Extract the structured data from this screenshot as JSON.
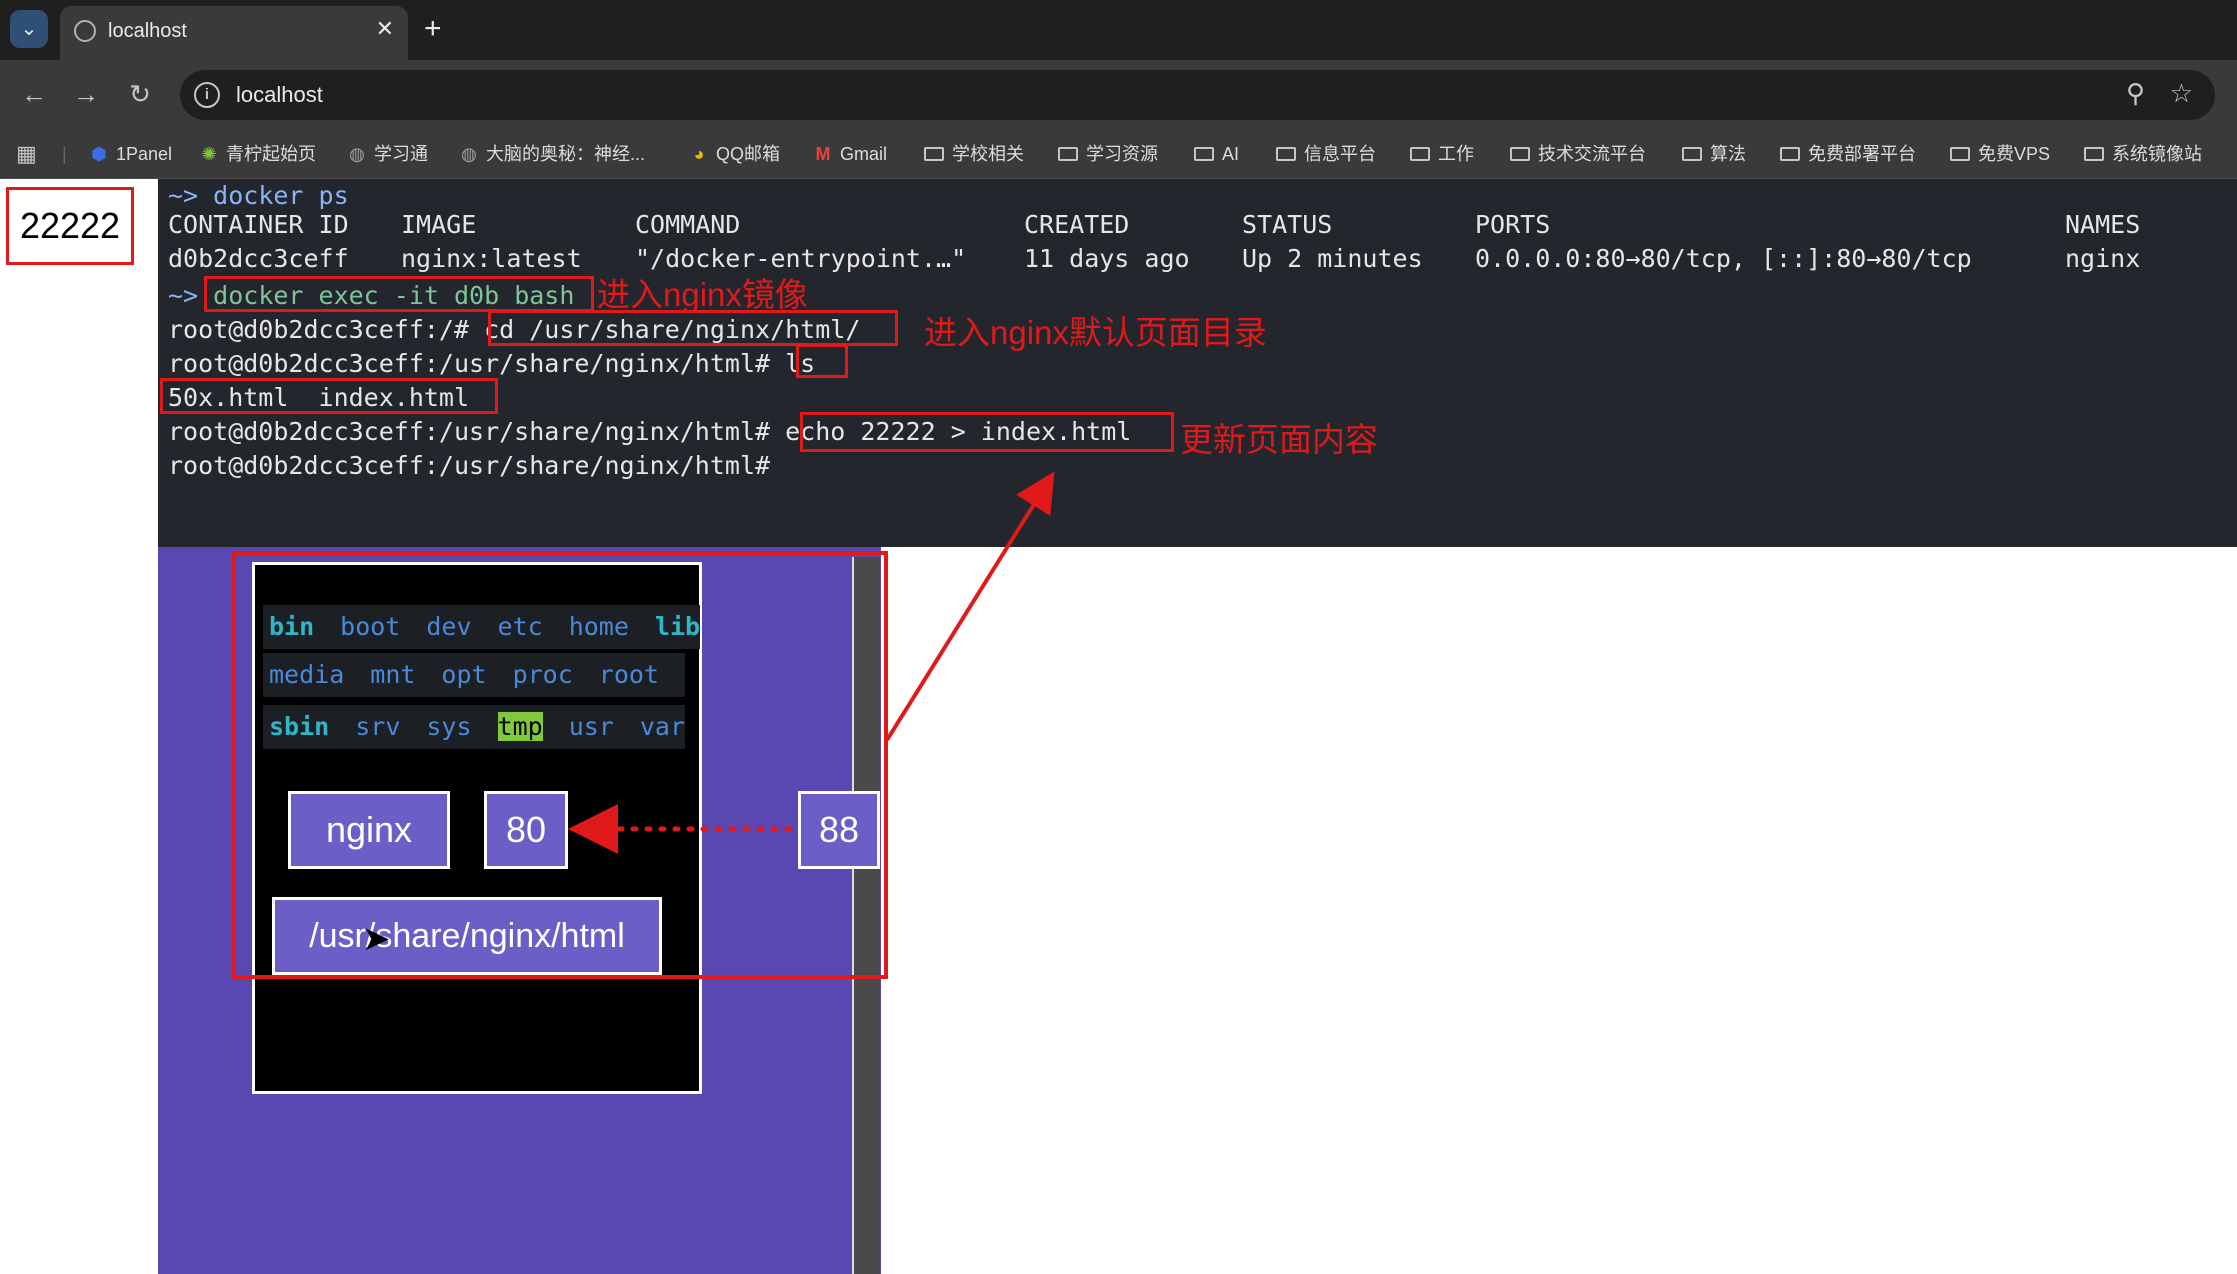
{
  "browser": {
    "tab_title": "localhost",
    "url": "localhost",
    "bookmarks": [
      {
        "label": "1Panel",
        "icon": "shield-icon"
      },
      {
        "label": "青柠起始页",
        "icon": "lime-icon"
      },
      {
        "label": "学习通",
        "icon": "globe-icon"
      },
      {
        "label": "大脑的奥秘：神经...",
        "icon": "globe-icon"
      },
      {
        "label": "QQ邮箱",
        "icon": "chrome-icon"
      },
      {
        "label": "Gmail",
        "icon": "gmail-icon"
      },
      {
        "label": "学校相关",
        "icon": "folder-icon"
      },
      {
        "label": "学习资源",
        "icon": "folder-icon"
      },
      {
        "label": "AI",
        "icon": "folder-icon"
      },
      {
        "label": "信息平台",
        "icon": "folder-icon"
      },
      {
        "label": "工作",
        "icon": "folder-icon"
      },
      {
        "label": "技术交流平台",
        "icon": "folder-icon"
      },
      {
        "label": "算法",
        "icon": "folder-icon"
      },
      {
        "label": "免费部署平台",
        "icon": "folder-icon"
      },
      {
        "label": "免费VPS",
        "icon": "folder-icon"
      },
      {
        "label": "系统镜像站",
        "icon": "folder-icon"
      }
    ]
  },
  "page": {
    "output": "22222"
  },
  "terminal": {
    "prompt_symbol": "~>",
    "cmd1": "docker ps",
    "headers": [
      "CONTAINER ID",
      "IMAGE",
      "COMMAND",
      "CREATED",
      "STATUS",
      "PORTS",
      "NAMES"
    ],
    "row": [
      "d0b2dcc3ceff",
      "nginx:latest",
      "\"/docker-entrypoint.…\"",
      "11 days ago",
      "Up 2 minutes",
      "0.0.0.0:80→80/tcp, [::]:80→80/tcp",
      "nginx"
    ],
    "cmd2": "docker exec -it d0b bash",
    "prompt_root": "root@d0b2dcc3ceff:/#",
    "cmd3": "cd /usr/share/nginx/html/",
    "prompt_html": "root@d0b2dcc3ceff:/usr/share/nginx/html#",
    "cmd4": "ls",
    "ls_output": "50x.html  index.html",
    "cmd5": "echo 22222 > index.html"
  },
  "annotations": {
    "enter_nginx": "进入nginx镜像",
    "enter_dir": "进入nginx默认页面目录",
    "update_page": "更新页面内容"
  },
  "diagram": {
    "dirs_row1": [
      "bin",
      "boot",
      "dev",
      "etc",
      "home",
      "lib"
    ],
    "dirs_row2": [
      "media",
      "mnt",
      "opt",
      "proc",
      "root"
    ],
    "dirs_row3": [
      "sbin",
      "srv",
      "sys",
      "tmp",
      "usr",
      "var"
    ],
    "container": "nginx",
    "container_port": "80",
    "host_port": "88",
    "path": "/usr/share/nginx/html"
  },
  "colors": {
    "annotation_red": "#e01a1a",
    "terminal_bg": "#23262d",
    "diagram_purple": "#5b47b1"
  }
}
